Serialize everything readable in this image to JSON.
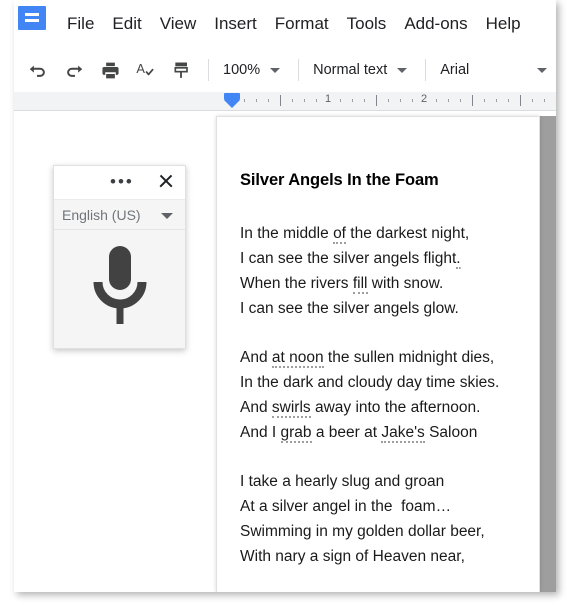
{
  "app": {
    "name": "Google Docs",
    "logo_icon": "docs-logo-icon"
  },
  "menubar": {
    "items": [
      {
        "label": "File"
      },
      {
        "label": "Edit"
      },
      {
        "label": "View"
      },
      {
        "label": "Insert"
      },
      {
        "label": "Format"
      },
      {
        "label": "Tools"
      },
      {
        "label": "Add-ons"
      },
      {
        "label": "Help"
      }
    ]
  },
  "toolbar": {
    "icons": [
      {
        "name": "undo-icon",
        "title": "Undo"
      },
      {
        "name": "redo-icon",
        "title": "Redo"
      },
      {
        "name": "print-icon",
        "title": "Print"
      },
      {
        "name": "spelling-check-icon",
        "title": "Spelling and grammar check"
      },
      {
        "name": "paint-format-icon",
        "title": "Paint format"
      }
    ],
    "zoom": {
      "value": "100%"
    },
    "style": {
      "value": "Normal text"
    },
    "font": {
      "value": "Arial"
    }
  },
  "ruler": {
    "numbers": [
      "1",
      "2"
    ],
    "indent_marker": "left-indent-marker",
    "accent_color": "#4285f4"
  },
  "voice_dialog": {
    "more_label": "•••",
    "close_label": "×",
    "language": "English (US)",
    "mic_icon": "microphone-icon",
    "mic_color": "#424242"
  },
  "document": {
    "title": "Silver Angels In the Foam",
    "stanzas": [
      {
        "lines": [
          [
            {
              "t": "In the middle "
            },
            {
              "t": "of",
              "s": true
            },
            {
              "t": " the darkest night,"
            }
          ],
          [
            {
              "t": "I can see the silver angels flight"
            },
            {
              "t": ".",
              "s": true
            }
          ],
          [
            {
              "t": "When the rivers "
            },
            {
              "t": "fill",
              "s": true
            },
            {
              "t": " with snow."
            }
          ],
          [
            {
              "t": "I can see the silver angels glow."
            }
          ]
        ]
      },
      {
        "lines": [
          [
            {
              "t": "And "
            },
            {
              "t": "at noon",
              "s": true
            },
            {
              "t": " the sullen midnight dies,"
            }
          ],
          [
            {
              "t": "In the dark and cloudy day time skies."
            }
          ],
          [
            {
              "t": "And "
            },
            {
              "t": "swirls",
              "s": true
            },
            {
              "t": " away into the afternoon."
            }
          ],
          [
            {
              "t": "And I "
            },
            {
              "t": "grab",
              "s": true
            },
            {
              "t": " a beer at "
            },
            {
              "t": "Jake's",
              "s": true
            },
            {
              "t": " Saloon"
            }
          ]
        ]
      },
      {
        "lines": [
          [
            {
              "t": "I take a hearly slug and groan"
            }
          ],
          [
            {
              "t": "At a silver angel in the  foam…"
            }
          ],
          [
            {
              "t": "Swimming in my golden dollar beer,"
            }
          ],
          [
            {
              "t": "With nary a sign of Heaven near,"
            }
          ]
        ]
      }
    ]
  }
}
